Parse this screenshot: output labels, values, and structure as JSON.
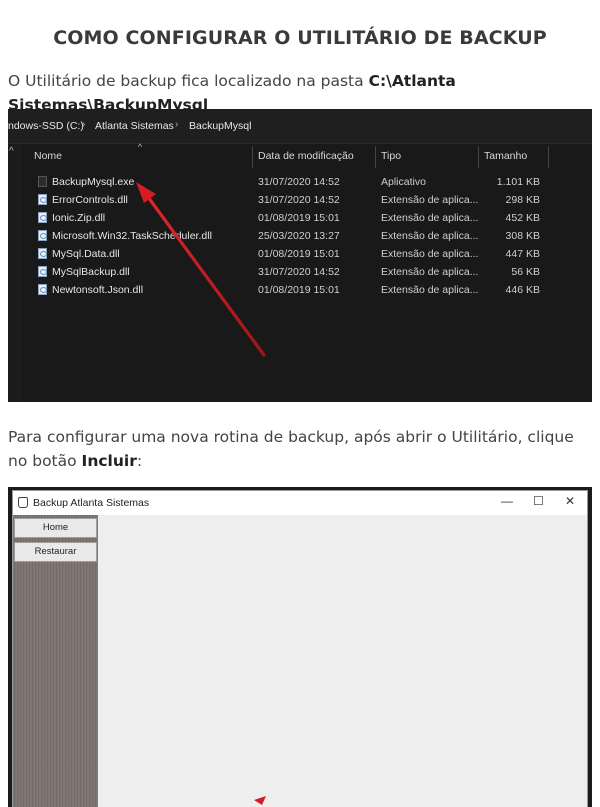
{
  "title": "COMO CONFIGURAR O UTILITÁRIO DE BACKUP",
  "intro": {
    "text": "O Utilitário de backup fica localizado na pasta ",
    "path": "C:\\Atlanta Sistemas\\BackupMysql"
  },
  "explorer": {
    "breadcrumb": [
      "ndows-SSD (C:)",
      "Atlanta Sistemas",
      "BackupMysql"
    ],
    "columns": [
      "Nome",
      "Data de modificação",
      "Tipo",
      "Tamanho"
    ],
    "files": [
      {
        "name": "BackupMysql.exe",
        "date": "31/07/2020 14:52",
        "type": "Aplicativo",
        "size": "1.101 KB",
        "icon": "exe-icon"
      },
      {
        "name": "ErrorControls.dll",
        "date": "31/07/2020 14:52",
        "type": "Extensão de aplica...",
        "size": "298 KB",
        "icon": "dll-icon"
      },
      {
        "name": "Ionic.Zip.dll",
        "date": "01/08/2019 15:01",
        "type": "Extensão de aplica...",
        "size": "452 KB",
        "icon": "dll-icon"
      },
      {
        "name": "Microsoft.Win32.TaskScheduler.dll",
        "date": "25/03/2020 13:27",
        "type": "Extensão de aplica...",
        "size": "308 KB",
        "icon": "dll-icon"
      },
      {
        "name": "MySql.Data.dll",
        "date": "01/08/2019 15:01",
        "type": "Extensão de aplica...",
        "size": "447 KB",
        "icon": "dll-icon"
      },
      {
        "name": "MySqlBackup.dll",
        "date": "31/07/2020 14:52",
        "type": "Extensão de aplica...",
        "size": "56 KB",
        "icon": "dll-icon"
      },
      {
        "name": "Newtonsoft.Json.dll",
        "date": "01/08/2019 15:01",
        "type": "Extensão de aplica...",
        "size": "446 KB",
        "icon": "dll-icon"
      }
    ],
    "arrow_color": "#c8161d"
  },
  "instruction": {
    "text": "Para configurar uma nova rotina de backup, após abrir o Utilitário, clique no botão ",
    "button": "Incluir",
    "suffix": ":"
  },
  "app": {
    "title": "Backup Atlanta Sistemas",
    "controls": {
      "minimize": "—",
      "maximize": "☐",
      "close": "✕"
    },
    "buttons": [
      "Home",
      "Restaurar"
    ]
  }
}
